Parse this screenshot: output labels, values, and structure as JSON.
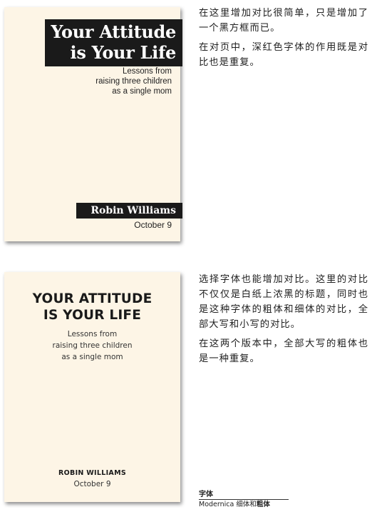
{
  "card1": {
    "title_lines": [
      "Your Attitude",
      "is Your Life"
    ],
    "subtitle_lines": [
      "Lessons from",
      "raising three children",
      "as a single mom"
    ],
    "author": "Robin Williams",
    "date": "October 9"
  },
  "card2": {
    "title_lines": [
      "YOUR ATTITUDE",
      "IS YOUR LIFE"
    ],
    "subtitle_lines": [
      "Lessons from",
      "raising three children",
      "as a single mom"
    ],
    "author": "ROBIN WILLIAMS",
    "date": "October 9"
  },
  "note1": {
    "paragraphs": [
      "在这里增加对比很简单，只是增加了一个黑方框而已。",
      "在对页中，深红色字体的作用既是对比也是重复。"
    ]
  },
  "note2": {
    "paragraphs": [
      "选择字体也能增加对比。这里的对比不仅仅是白纸上浓黑的标题，同时也是这种字体的粗体和细体的对比，全部大写和小写的对比。",
      "在这两个版本中，全部大写的粗体也是一种重复。"
    ]
  },
  "caption": {
    "title": "字体",
    "font_name": "Modernica ",
    "thin": "细体",
    "and": "和",
    "bold": "粗体"
  },
  "colors": {
    "card_bg": "#fdf5e6",
    "title_box": "#1a1a1a"
  }
}
